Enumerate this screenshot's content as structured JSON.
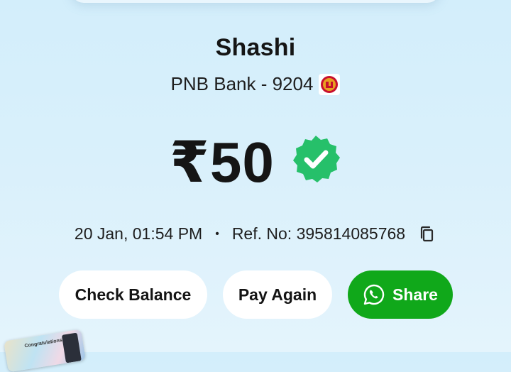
{
  "payee": {
    "name": "Shashi",
    "bank": "PNB Bank - 9204"
  },
  "payment": {
    "amount": "₹50",
    "status_icon": "verified-check-icon",
    "date_time": "20 Jan, 01:54 PM",
    "separator": "•",
    "reference": "Ref. No: 395814085768"
  },
  "actions": {
    "check_balance": "Check Balance",
    "pay_again": "Pay Again",
    "share": "Share"
  },
  "promo": {
    "text": "Congratulations"
  },
  "colors": {
    "share_green": "#10a81a",
    "verified_green": "#26c06a",
    "bank_logo_red": "#c8102e"
  }
}
